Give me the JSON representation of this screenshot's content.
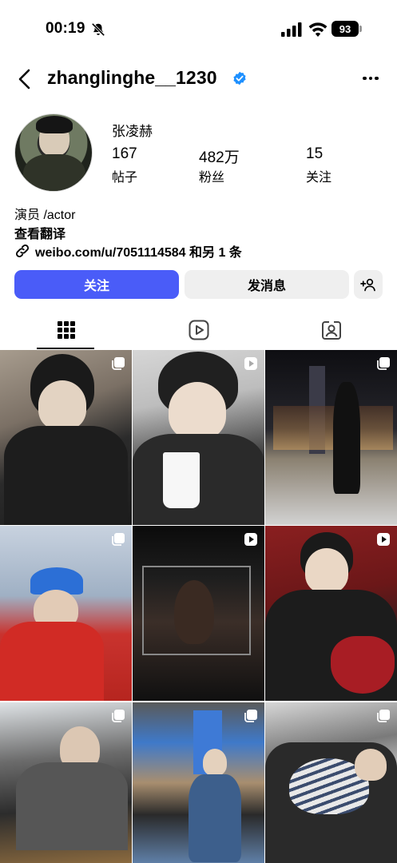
{
  "status_bar": {
    "time": "00:19",
    "battery": "93"
  },
  "header": {
    "username": "zhanglinghe__1230"
  },
  "profile": {
    "display_name": "张凌赫",
    "stats": [
      {
        "value": "167",
        "label": "帖子"
      },
      {
        "value": "482万",
        "label": "粉丝"
      },
      {
        "value": "15",
        "label": "关注"
      }
    ],
    "bio_category": "演员 /actor",
    "translate_label": "查看翻译",
    "link_text": "weibo.com/u/7051114584 和另 1 条"
  },
  "actions": {
    "follow_label": "关注",
    "message_label": "发消息"
  },
  "colors": {
    "accent": "#4a5cf8",
    "verified": "#1e90ff",
    "secondary_button": "#efefef"
  },
  "tabs": [
    "grid-icon",
    "reels-icon",
    "tagged-icon"
  ],
  "grid": [
    {
      "badge": "carousel-icon"
    },
    {
      "badge": "reel-icon"
    },
    {
      "badge": "carousel-icon"
    },
    {
      "badge": "carousel-icon"
    },
    {
      "badge": "reel-icon"
    },
    {
      "badge": "reel-icon"
    },
    {
      "badge": "carousel-icon"
    },
    {
      "badge": "carousel-icon"
    },
    {
      "badge": "carousel-icon"
    }
  ]
}
